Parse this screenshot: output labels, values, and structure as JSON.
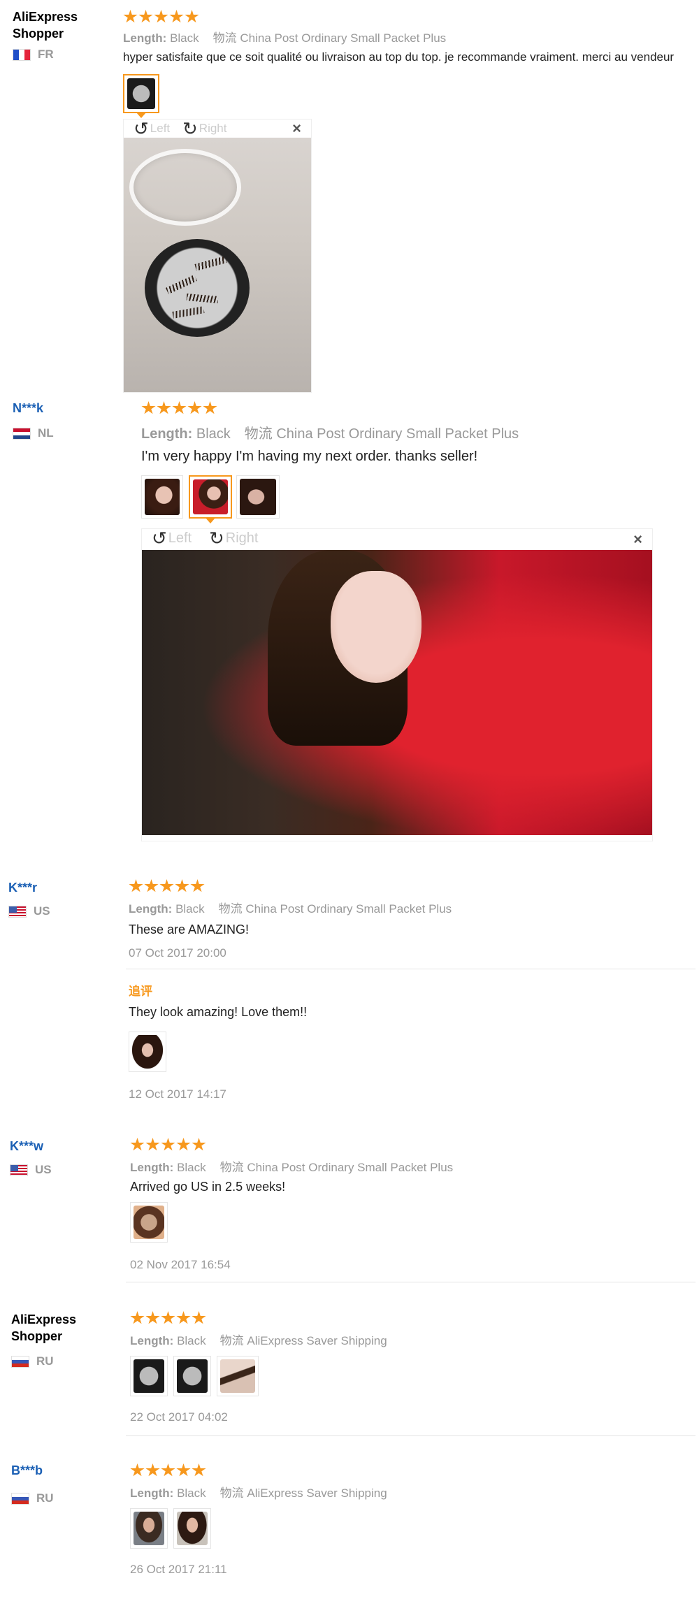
{
  "reviews": [
    {
      "user": "AliExpress Shopper",
      "country": "FR",
      "attr_label": "Length:",
      "attr_value": "Black",
      "shipping_label": "物流",
      "shipping": "China Post Ordinary Small Packet Plus",
      "text": "hyper satisfaite que ce soit qualité ou livraison au top du top. je recommande vraiment. merci au vendeur",
      "viewer": {
        "left": "Left",
        "right": "Right",
        "close": "×"
      }
    },
    {
      "user": "N***k",
      "country": "NL",
      "attr_label": "Length:",
      "attr_value": "Black",
      "shipping_label": "物流",
      "shipping": "China Post Ordinary Small Packet Plus",
      "text": "I'm very happy I'm having my next order. thanks seller!",
      "viewer": {
        "left": "Left",
        "right": "Right",
        "close": "×"
      }
    },
    {
      "user": "K***r",
      "country": "US",
      "attr_label": "Length:",
      "attr_value": "Black",
      "shipping_label": "物流",
      "shipping": "China Post Ordinary Small Packet Plus",
      "text": "These are AMAZING!",
      "date": "07 Oct 2017 20:00",
      "followup_label": "追评",
      "followup_text": "They look amazing! Love them!!",
      "followup_date": "12 Oct 2017 14:17"
    },
    {
      "user": "K***w",
      "country": "US",
      "attr_label": "Length:",
      "attr_value": "Black",
      "shipping_label": "物流",
      "shipping": "China Post Ordinary Small Packet Plus",
      "text": "Arrived go US in 2.5 weeks!",
      "date": "02 Nov 2017 16:54"
    },
    {
      "user": "AliExpress Shopper",
      "country": "RU",
      "attr_label": "Length:",
      "attr_value": "Black",
      "shipping_label": "物流",
      "shipping": "AliExpress Saver Shipping",
      "date": "22 Oct 2017 04:02"
    },
    {
      "user": "B***b",
      "country": "RU",
      "attr_label": "Length:",
      "attr_value": "Black",
      "shipping_label": "物流",
      "shipping": "AliExpress Saver Shipping",
      "date": "26 Oct 2017 21:11"
    }
  ],
  "rating_stars": 5,
  "colors": {
    "star": "#f7981d",
    "accent": "#f7981d",
    "link": "#1a5fb4"
  }
}
